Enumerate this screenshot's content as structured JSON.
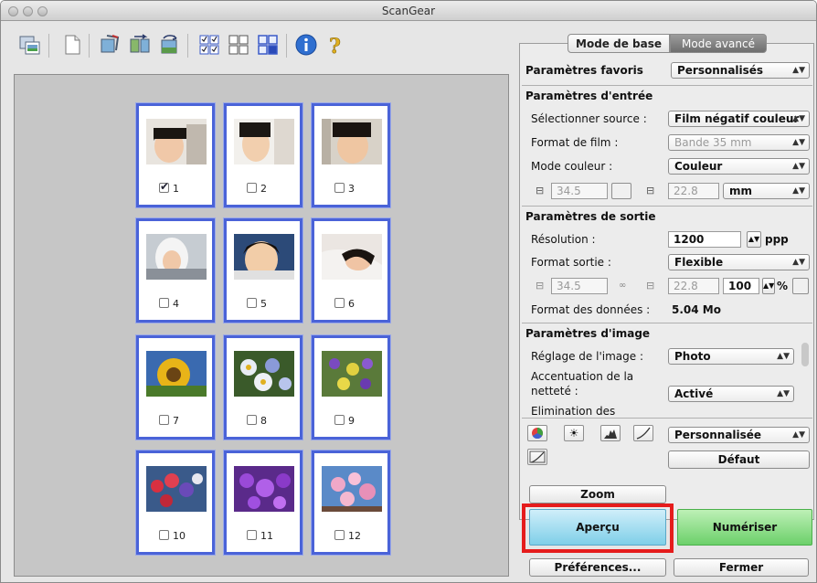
{
  "window": {
    "title": "ScanGear"
  },
  "tabs": {
    "basic": "Mode de base",
    "advanced": "Mode avancé"
  },
  "favorites": {
    "label": "Paramètres favoris",
    "value": "Personnalisés"
  },
  "input": {
    "section": "Paramètres d'entrée",
    "source_label": "Sélectionner source :",
    "source_value": "Film négatif couleur",
    "film_label": "Format de film :",
    "film_value": "Bande 35 mm",
    "color_label": "Mode couleur :",
    "color_value": "Couleur",
    "width": "34.5",
    "height": "22.8",
    "unit": "mm"
  },
  "output": {
    "section": "Paramètres de sortie",
    "resolution_label": "Résolution :",
    "resolution_value": "1200",
    "resolution_unit": "ppp",
    "format_label": "Format sortie :",
    "format_value": "Flexible",
    "width": "34.5",
    "height": "22.8",
    "scale": "100",
    "scale_unit": "%",
    "data_label": "Format des données :",
    "data_value": "5.04 Mo"
  },
  "image": {
    "section": "Paramètres d'image",
    "adjust_label": "Réglage de l'image :",
    "adjust_value": "Photo",
    "sharp_label_1": "Accentuation de la",
    "sharp_label_2": "netteté :",
    "sharp_value": "Activé",
    "dust_label": "Elimination des"
  },
  "tone": {
    "preset": "Personnalisée",
    "default_button": "Défaut"
  },
  "buttons": {
    "zoom": "Zoom",
    "preview": "Aperçu",
    "scan": "Numériser",
    "preferences": "Préférences...",
    "close": "Fermer"
  },
  "frames": [
    {
      "label": "1",
      "checked": true
    },
    {
      "label": "2",
      "checked": false
    },
    {
      "label": "3",
      "checked": false
    },
    {
      "label": "4",
      "checked": false
    },
    {
      "label": "5",
      "checked": false
    },
    {
      "label": "6",
      "checked": false
    },
    {
      "label": "7",
      "checked": false
    },
    {
      "label": "8",
      "checked": false
    },
    {
      "label": "9",
      "checked": false
    },
    {
      "label": "10",
      "checked": false
    },
    {
      "label": "11",
      "checked": false
    },
    {
      "label": "12",
      "checked": false
    }
  ],
  "colors": {
    "frame_border": "#4a63d8",
    "preview_gradient": [
      "#cfeefa",
      "#7fcfe8"
    ],
    "scan_gradient": [
      "#bdf0b6",
      "#6cd06a"
    ],
    "highlight": "#e51c1c"
  },
  "toolbar_icons": [
    "scanner-photos-icon",
    "page-icon",
    "crop-rotate-icon",
    "mirror-icon",
    "rotate-icon",
    "select-all-frames-icon",
    "thumbnail-grid-icon",
    "clear-selection-icon",
    "info-icon",
    "help-icon"
  ]
}
